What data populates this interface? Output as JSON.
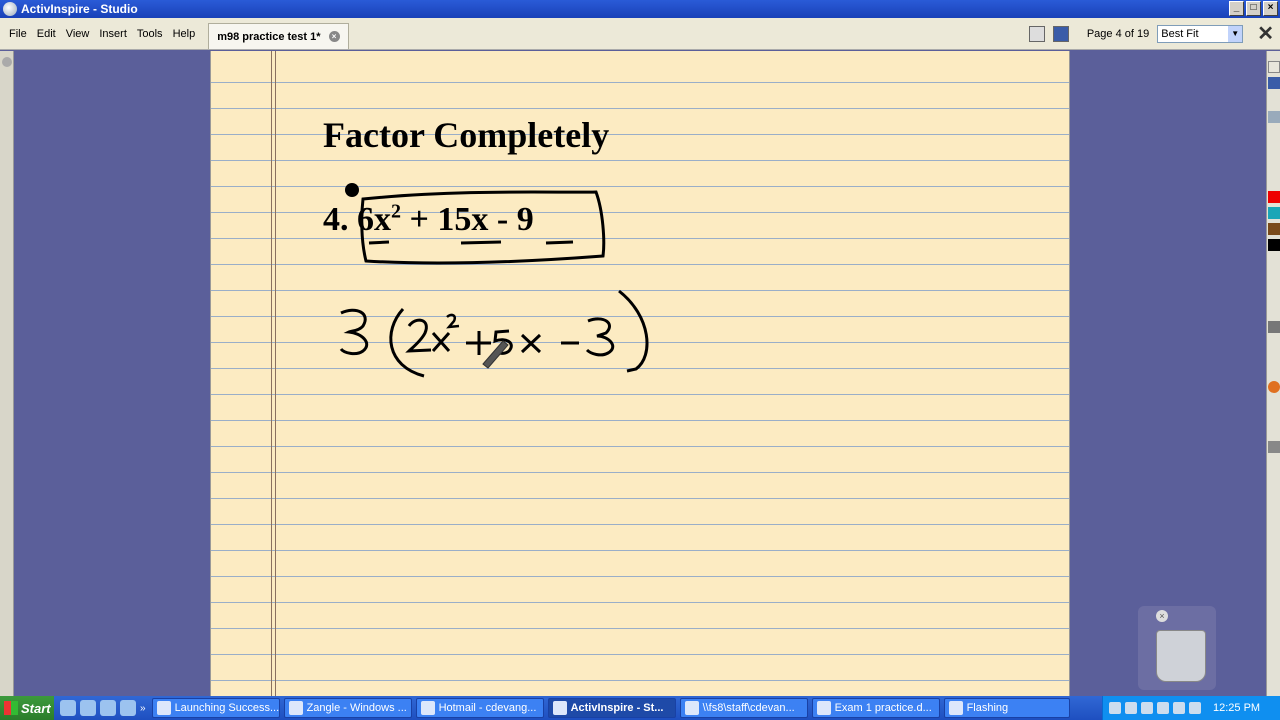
{
  "window": {
    "title": "ActivInspire - Studio"
  },
  "menu": [
    "File",
    "Edit",
    "View",
    "Insert",
    "Tools",
    "Help"
  ],
  "document_tab": {
    "label": "m98 practice test 1*"
  },
  "toolbar": {
    "page_label": "Page 4 of 19",
    "zoom_value": "Best Fit"
  },
  "flipchart": {
    "heading": "Factor Completely",
    "problem_number": "4.",
    "problem_expression_part1": "6x",
    "problem_exponent": "2",
    "problem_expression_part2": " + 15x - 9",
    "handwritten_work": "3(2x² + 5x - 3)"
  },
  "taskbar": {
    "start_label": "Start",
    "tasks": [
      "Launching Success...",
      "Zangle - Windows ...",
      "Hotmail - cdevang...",
      "ActivInspire - St...",
      "\\\\fs8\\staff\\cdevan...",
      "Exam 1 practice.d...",
      "Flashing"
    ],
    "clock": "12:25 PM"
  },
  "colors": {
    "paper": "#fcebc2",
    "background": "#5b5f9a",
    "title_bar": "#2a5bd7",
    "taskbar": "#3168d5"
  }
}
